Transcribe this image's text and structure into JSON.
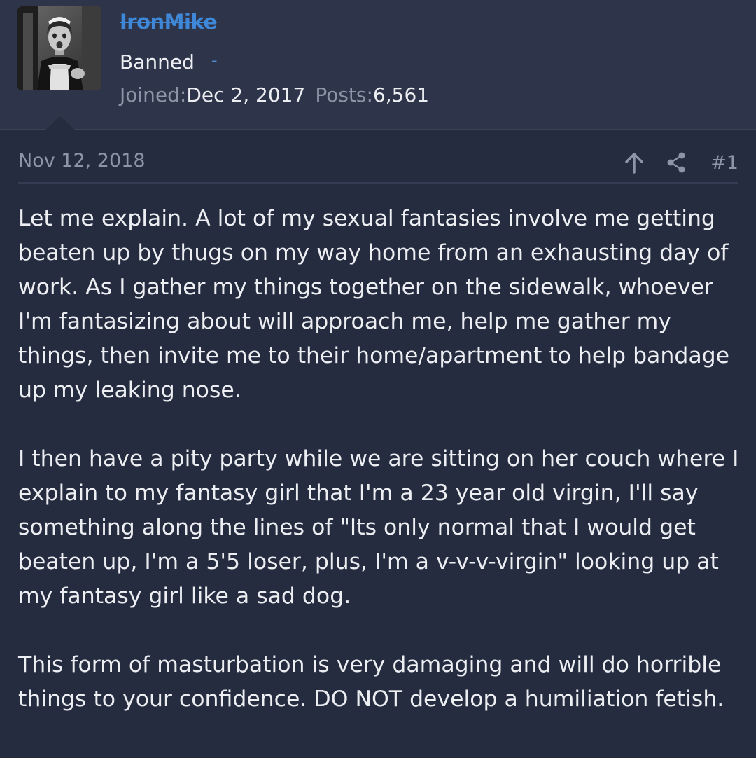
{
  "user": {
    "name": "IronMike",
    "title": "Banned",
    "separator": "-",
    "joined_label": "Joined:",
    "joined_value": "Dec 2, 2017",
    "posts_label": "Posts:",
    "posts_value": "6,561"
  },
  "post": {
    "date": "Nov 12, 2018",
    "number": "#1",
    "paragraphs": [
      "Let me explain. A lot of my sexual fantasies involve me getting beaten up by thugs on my way home from an exhausting day of work. As I gather my things together on the sidewalk, whoever I'm fantasizing about will approach me, help me gather my things, then invite me to their home/apartment to help bandage up my leaking nose.",
      "I then have a pity party while we are sitting on her couch where I explain to my fantasy girl that I'm a 23 year old virgin, I'll say something along the lines of \"Its only normal that I would get beaten up, I'm a 5'5 loser, plus, I'm a v-v-v-virgin\" looking up at my fantasy girl like a sad dog.",
      "This form of masturbation is very damaging and will do horrible things to your confidence. DO NOT develop a humiliation fetish."
    ]
  },
  "icons": {
    "upvote": "arrow-up-icon",
    "share": "share-icon"
  },
  "colors": {
    "page_background": "#262c40",
    "header_background": "#2e344a",
    "username": "#3f88d8",
    "muted_text": "#8d94a7",
    "body_text": "#eceef2"
  }
}
